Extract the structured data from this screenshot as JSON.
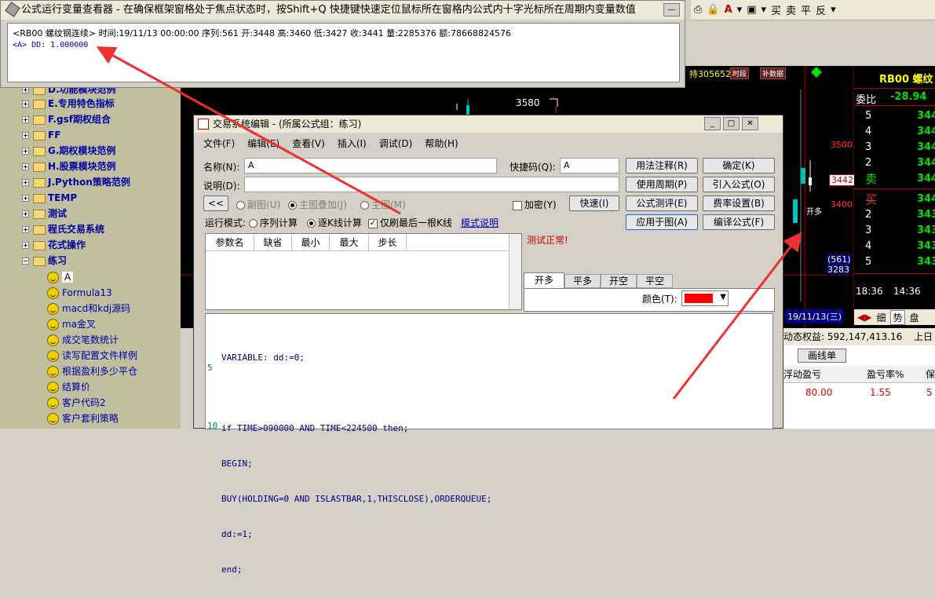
{
  "toolbar": {
    "items": [
      "⎙",
      "🔒",
      "A",
      "▾",
      "▣",
      "▾",
      "买",
      "卖",
      "平",
      "反",
      "▾"
    ]
  },
  "viewer": {
    "title": "公式运行变量查看器 - 在确保框架窗格处于焦点状态时，按Shift+Q 快捷键快速定位鼠标所在窗格内公式内十字光标所在周期内变量数值",
    "line1": "<RB00 螺纹钢连续> 时间:19/11/13 00:00:00 序列:561 开:3448 高:3460 低:3427 收:3441 量:2285376 额:78668824576",
    "line2": "<A> DD: 1.000000"
  },
  "tree": {
    "nodes": [
      "D.功能模块范例",
      "E.专用特色指标",
      "F.gsf期权组合",
      "FF",
      "G.期权模块范例",
      "H.股票模块范例",
      "J.Python策略范例",
      "TEMP",
      "测试",
      "程氏交易系统",
      "花式操作",
      "练习"
    ],
    "leaves": [
      "A",
      "Formula13",
      "macd和kdj源码",
      "ma金叉",
      "成交笔数统计",
      "读写配置文件样例",
      "根据盈利多少平仓",
      "结算价",
      "客户代码2",
      "客户套利策略"
    ]
  },
  "editor": {
    "title": "交易系统编辑 - (所属公式组：练习)",
    "menu": [
      "文件(F)",
      "编辑(E)",
      "查看(V)",
      "插入(I)",
      "调试(D)",
      "帮助(H)"
    ],
    "name_label": "名称(N):",
    "name_value": "A",
    "shortcut_label": "快捷码(Q):",
    "shortcut_value": "A",
    "desc_label": "说明(D):",
    "sub_chart": "副图(U)",
    "main_overlay": "主图叠加(J)",
    "main_chart": "主图(M)",
    "encrypt": "加密(Y)",
    "fast": "快速(I)",
    "mode_label": "运行模式:",
    "mode_seq": "序列计算",
    "mode_tick": "逐K线计算",
    "only_last": "仅刷最后一根K线",
    "mode_help": "模式说明",
    "param_headers": [
      "参数名",
      "缺省",
      "最小",
      "最大",
      "步长"
    ],
    "test_ok": "测试正常!",
    "tabs": [
      "开多",
      "平多",
      "开空",
      "平空"
    ],
    "color_label": "颜色(T):",
    "buttons": [
      "用法注释(R)",
      "确定(K)",
      "使用周期(P)",
      "引入公式(O)",
      "公式测评(E)",
      "费率设置(B)",
      "应用于图(A)",
      "编译公式(F)"
    ],
    "code": [
      "VARIABLE: dd:=0;",
      "",
      "if TIME>090000 AND TIME<224500 then;",
      "BEGIN;",
      "BUY(HOLDING=0 AND ISLASTBAR,1,THISCLOSE),ORDERQUEUE;",
      "dd:=1;",
      "end;"
    ],
    "line_numbers": [
      "5",
      "10"
    ]
  },
  "chart": {
    "hold": "持305652",
    "btn1": "时段",
    "btn2": "补数据",
    "p3580": "3580",
    "p3500": "3500",
    "p3442": "3442",
    "p3400": "3400",
    "open_label": "开多",
    "seq": "(561)",
    "low": "3283",
    "date": "19/11/13(三)"
  },
  "quotes": {
    "symbol": "RB00 螺纹",
    "weibi_label": "委比",
    "weibi_value": "-28.94",
    "sell_levels": [
      "5",
      "4",
      "3",
      "2"
    ],
    "sell_label": "卖",
    "buy_label": "买",
    "buy_levels": [
      "2",
      "3",
      "4",
      "5"
    ],
    "sell_prices": [
      "344",
      "344",
      "344",
      "344",
      "344"
    ],
    "buy_prices": [
      "344",
      "343",
      "343",
      "343",
      "343"
    ],
    "time1": "18:36",
    "time2": "14:36",
    "tab1": "细",
    "tab2": "势",
    "tab3": "盘"
  },
  "account": {
    "dyn_label": "动态权益: 592,147,413.16",
    "prev_label": "上日",
    "draw_btn": "画线单",
    "headers": [
      "浮动盈亏",
      "盈亏率%",
      "保"
    ],
    "row": [
      "80.00",
      "1.55",
      "5"
    ]
  }
}
